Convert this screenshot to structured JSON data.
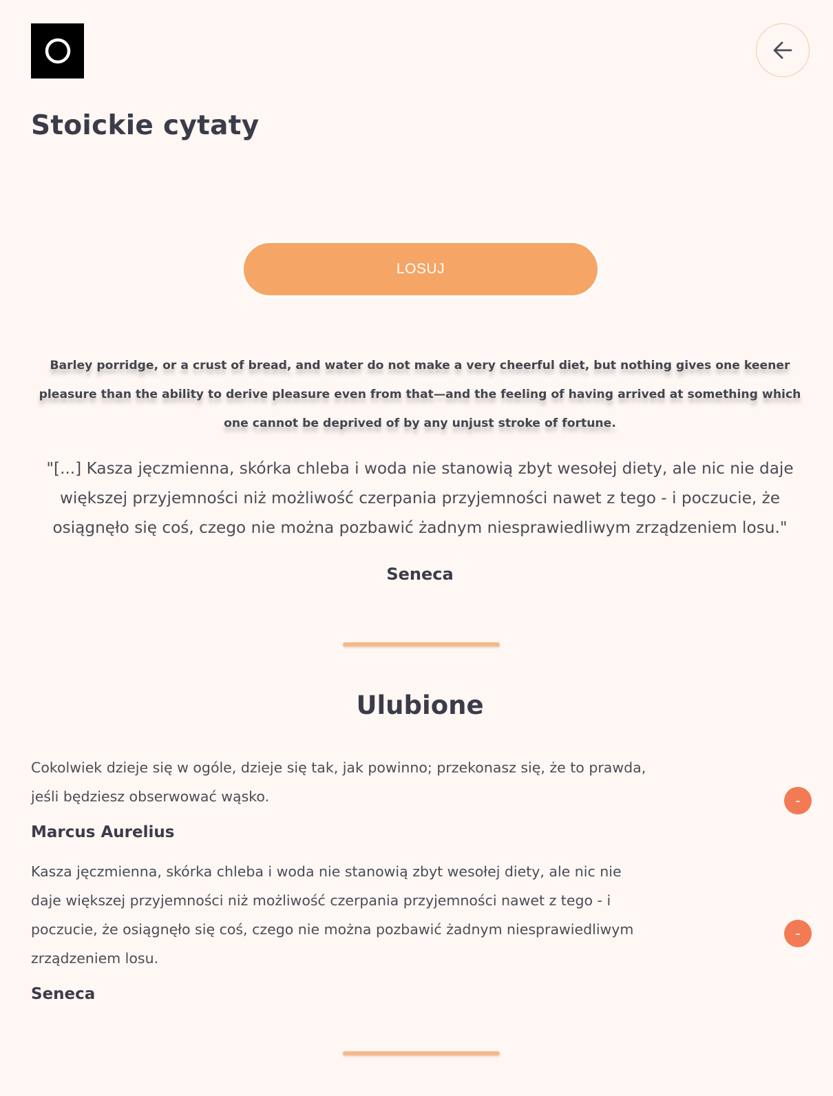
{
  "header": {
    "logo_icon": "circle-logo-icon",
    "back_icon": "arrow-left-icon",
    "title": "Stoickie cytaty"
  },
  "draw_button": {
    "label": "LOSUJ"
  },
  "current_quote": {
    "original": "Barley porridge, or a crust of bread, and water do not make a very cheerful diet, but nothing gives one keener pleasure than the ability to derive pleasure even from that—and the feeling of having arrived at something which one cannot be deprived of by any unjust stroke of fortune.",
    "translation": "\"[...] Kasza jęczmienna, skórka chleba i woda nie stanowią zbyt wesołej diety, ale nic nie daje większej przyjemności niż możliwość czerpania przyjemności nawet z tego - i poczucie, że osiągnęło się coś, czego nie można pozbawić żadnym niesprawiedliwym zrządzeniem losu.\"",
    "author": "Seneca"
  },
  "favorites": {
    "heading": "Ulubione",
    "remove_label": "-",
    "items": [
      {
        "text": "Cokolwiek dzieje się w ogóle, dzieje się tak, jak powinno; przekonasz się, że to prawda, jeśli będziesz obserwować wąsko.",
        "author": "Marcus Aurelius"
      },
      {
        "text": "Kasza jęczmienna, skórka chleba i woda nie stanowią zbyt wesołej diety, ale nic nie daje większej przyjemności niż możliwość czerpania przyjemności nawet z tego - i poczucie, że osiągnęło się coś, czego nie można pozbawić żadnym niesprawiedliwym zrządzeniem losu.",
        "author": "Seneca"
      }
    ]
  },
  "colors": {
    "background": "#fef7f3",
    "accent": "#f5a566",
    "divider": "#f7b888",
    "remove": "#f27a55",
    "text": "#3a3c4a"
  }
}
